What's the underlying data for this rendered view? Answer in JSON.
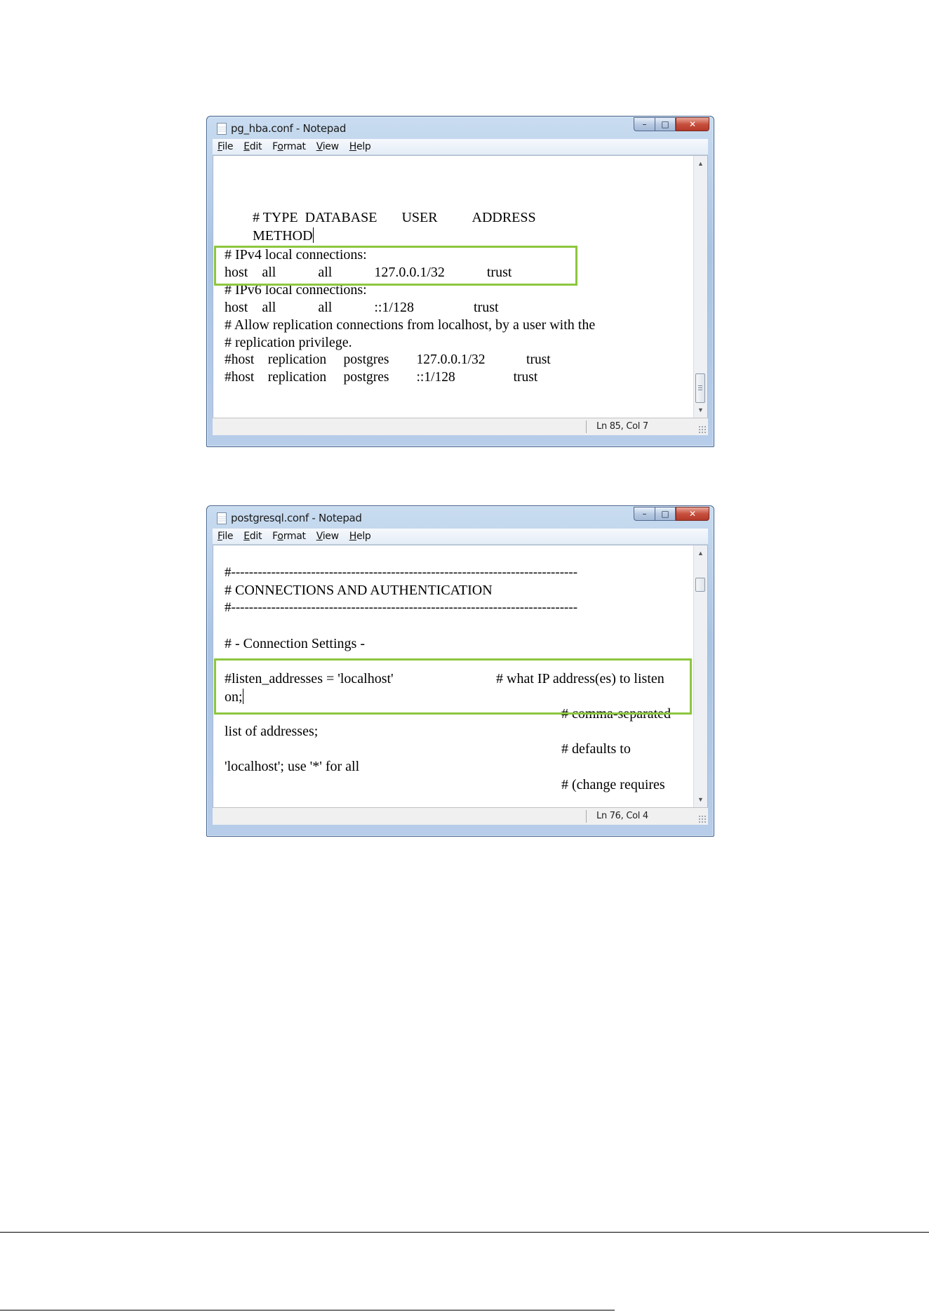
{
  "windows": [
    {
      "title": "pg_hba.conf - Notepad",
      "menu": [
        {
          "label": "File",
          "accel": "F"
        },
        {
          "label": "Edit",
          "accel": "E"
        },
        {
          "label": "Format",
          "accel": "o"
        },
        {
          "label": "View",
          "accel": "V"
        },
        {
          "label": "Help",
          "accel": "H"
        }
      ],
      "lines": [
        "# TYPE  DATABASE       USER          ADDRESS",
        "METHOD",
        "# IPv4 local connections:",
        "host    all            all            127.0.0.1/32            trust",
        "# IPv6 local connections:",
        "host    all            all            ::1/128                 trust",
        "# Allow replication connections from localhost, by a user with the",
        "# replication privilege.",
        "#host    replication     postgres        127.0.0.1/32            trust",
        "#host    replication     postgres        ::1/128                 trust"
      ],
      "status": "Ln 85, Col 7"
    },
    {
      "title": "postgresql.conf - Notepad",
      "menu": [
        {
          "label": "File",
          "accel": "F"
        },
        {
          "label": "Edit",
          "accel": "E"
        },
        {
          "label": "Format",
          "accel": "o"
        },
        {
          "label": "View",
          "accel": "V"
        },
        {
          "label": "Help",
          "accel": "H"
        }
      ],
      "lines": [
        "#------------------------------------------------------------------------------",
        "# CONNECTIONS AND AUTHENTICATION",
        "#------------------------------------------------------------------------------",
        "# - Connection Settings -",
        "#listen_addresses = 'localhost'",
        "# what IP address(es) to listen",
        "on;",
        "# comma-separated",
        "list of addresses;",
        "# defaults to",
        "'localhost'; use '*' for all",
        "# (change requires"
      ],
      "status": "Ln 76, Col 4"
    }
  ],
  "highlight_color": "#8dc63f"
}
